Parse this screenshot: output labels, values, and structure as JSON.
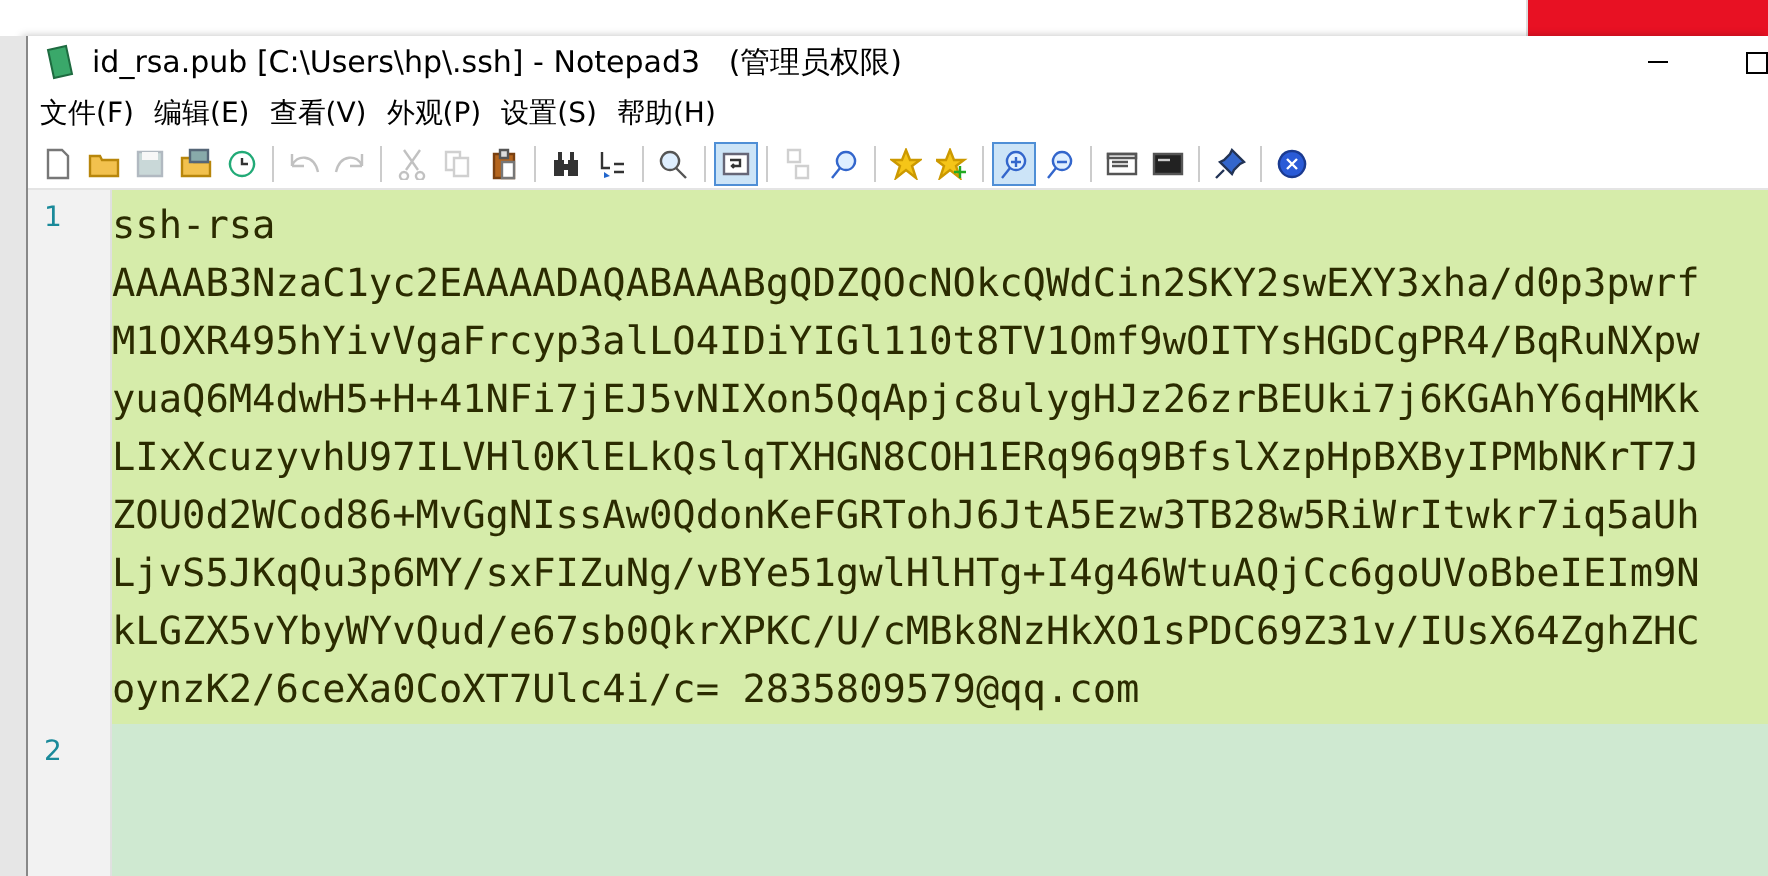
{
  "window": {
    "title": "id_rsa.pub [C:\\Users\\hp\\.ssh] - Notepad3   (管理员权限)"
  },
  "menu": [
    "文件(F)",
    "编辑(E)",
    "查看(V)",
    "外观(P)",
    "设置(S)",
    "帮助(H)"
  ],
  "toolbar": [
    {
      "kind": "button",
      "on": false,
      "disabled": false
    },
    {
      "kind": "button",
      "on": false,
      "disabled": false
    },
    {
      "kind": "button",
      "on": false,
      "disabled": true
    },
    {
      "kind": "button",
      "on": false,
      "disabled": false
    },
    {
      "kind": "button",
      "on": false,
      "disabled": false
    },
    {
      "kind": "separator"
    },
    {
      "kind": "button",
      "on": false,
      "disabled": true
    },
    {
      "kind": "button",
      "on": false,
      "disabled": true
    },
    {
      "kind": "separator"
    },
    {
      "kind": "button",
      "on": false,
      "disabled": true
    },
    {
      "kind": "button",
      "on": false,
      "disabled": true
    },
    {
      "kind": "button",
      "on": false,
      "disabled": false
    },
    {
      "kind": "separator"
    },
    {
      "kind": "button",
      "on": false,
      "disabled": false
    },
    {
      "kind": "button",
      "on": false,
      "disabled": false
    },
    {
      "kind": "separator"
    },
    {
      "kind": "button",
      "on": false,
      "disabled": false
    },
    {
      "kind": "separator"
    },
    {
      "kind": "button",
      "on": true,
      "disabled": false
    },
    {
      "kind": "separator"
    },
    {
      "kind": "button",
      "on": false,
      "disabled": true
    },
    {
      "kind": "button",
      "on": false,
      "disabled": false
    },
    {
      "kind": "separator"
    },
    {
      "kind": "button",
      "on": false,
      "disabled": false
    },
    {
      "kind": "button",
      "on": false,
      "disabled": false
    },
    {
      "kind": "separator"
    },
    {
      "kind": "button",
      "on": true,
      "disabled": false
    },
    {
      "kind": "button",
      "on": false,
      "disabled": false
    },
    {
      "kind": "separator"
    },
    {
      "kind": "button",
      "on": false,
      "disabled": false
    },
    {
      "kind": "button",
      "on": false,
      "disabled": false
    },
    {
      "kind": "separator"
    },
    {
      "kind": "button",
      "on": false,
      "disabled": false
    },
    {
      "kind": "separator"
    },
    {
      "kind": "button",
      "on": false,
      "disabled": false
    }
  ],
  "editor": {
    "lines": [
      {
        "number": "1",
        "selected": true,
        "current": false,
        "text": [
          "ssh-rsa",
          "AAAAB3NzaC1yc2EAAAADAQABAAABgQDZQOcNOkcQWdCin2SKY2swEXY3xha/d0p3pwrf",
          "M1OXR495hYivVgaFrcyp3alLO4IDiYIGl110t8TV1Omf9wOITYsHGDCgPR4/BqRuNXpw",
          "yuaQ6M4dwH5+H+41NFi7jEJ5vNIXon5QqApjc8ulygHJz26zrBEUki7j6KGAhY6qHMKk",
          "LIxXcuzyvhU97ILVHl0KlELkQslqTXHGN8COH1ERq96q9BfslXzpHpBXByIPMbNKrT7J",
          "ZOU0d2WCod86+MvGgNIssAw0QdonKeFGRTohJ6JtA5Ezw3TB28w5RiWrItwkr7iq5aUh",
          "LjvS5JKqQu3p6MY/sxFIZuNg/vBYe51gwlHlHTg+I4g46WtuAQjCc6goUVoBbeIEIm9N",
          "kLGZX5vYbyWYvQud/e67sb0QkrXPKC/U/cMBk8NzHkXO1sPDC69Z31v/IUsX64ZghZHC",
          "oynzK2/6ceXa0CoXT7Ulc4i/c= 2835809579@qq.com"
        ]
      },
      {
        "number": "2",
        "selected": false,
        "current": true
      }
    ]
  }
}
